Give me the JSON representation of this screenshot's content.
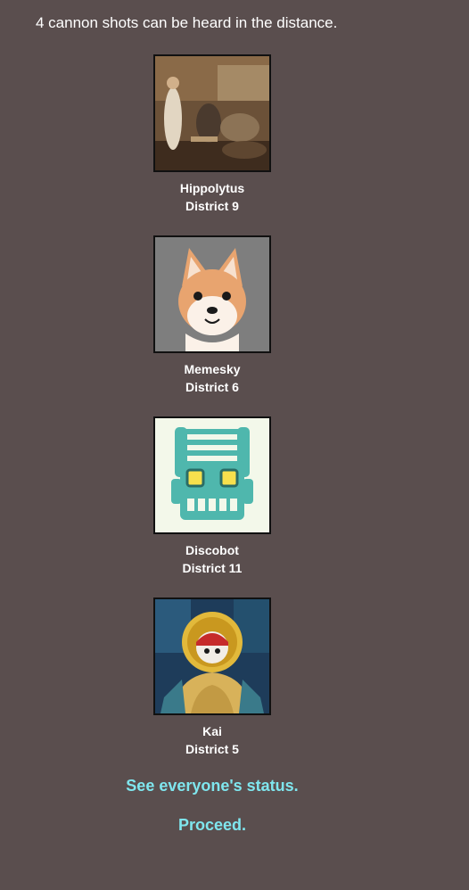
{
  "announcement": "4 cannon shots can be heard in the distance.",
  "tributes": [
    {
      "name": "Hippolytus",
      "district": "District 9",
      "avatar_icon": "classical-painting-avatar"
    },
    {
      "name": "Memesky",
      "district": "District 6",
      "avatar_icon": "shiba-dog-avatar"
    },
    {
      "name": "Discobot",
      "district": "District 11",
      "avatar_icon": "robot-avatar"
    },
    {
      "name": "Kai",
      "district": "District 5",
      "avatar_icon": "stained-glass-saint-avatar"
    }
  ],
  "links": {
    "status": "See everyone's status.",
    "proceed": "Proceed."
  },
  "colors": {
    "background": "#5a4e4e",
    "link": "#7fe6ee",
    "text": "#ffffff"
  }
}
